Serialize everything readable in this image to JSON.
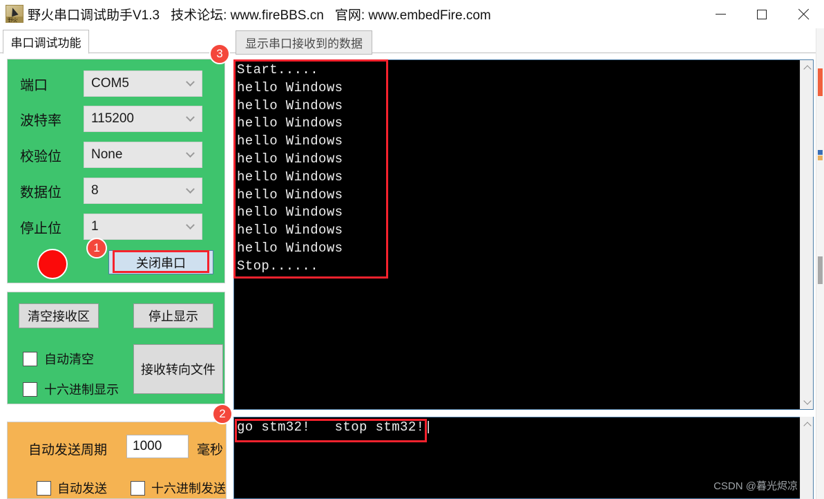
{
  "window": {
    "app_icon_name": "yehuo-logo-icon",
    "title_main": "野火串口调试助手V1.3",
    "title_forum": "技术论坛: www.fireBBS.cn",
    "title_site": "官网: www.embedFire.com",
    "minimize": "—",
    "maximize": "□",
    "close": "✕"
  },
  "tabs": {
    "left": "串口调试功能",
    "right": "显示串口接收到的数据"
  },
  "settings": {
    "rows": [
      {
        "label": "端口",
        "value": "COM5"
      },
      {
        "label": "波特率",
        "value": "115200"
      },
      {
        "label": "校验位",
        "value": "None"
      },
      {
        "label": "数据位",
        "value": "8"
      },
      {
        "label": "停止位",
        "value": "1"
      }
    ],
    "led_color": "#fb0a0a",
    "close_port_button": "关闭串口"
  },
  "receive_panel": {
    "clear_button": "清空接收区",
    "stop_button": "停止显示",
    "to_file_button": "接收转向文件",
    "auto_clear_label": "自动清空",
    "hex_display_label": "十六进制显示",
    "auto_clear_checked": false,
    "hex_display_checked": false
  },
  "send_panel": {
    "period_label": "自动发送周期",
    "period_value": "1000",
    "unit_label": "毫秒",
    "auto_send_label": "自动发送",
    "hex_send_label": "十六进制发送",
    "auto_send_checked": false,
    "hex_send_checked": false
  },
  "terminal": {
    "received_text": "Start.....\nhello Windows\nhello Windows\nhello Windows\nhello Windows\nhello Windows\nhello Windows\nhello Windows\nhello Windows\nhello Windows\nhello Windows\nStop......",
    "sent_text": "go stm32!   stop stm32!|"
  },
  "annotations": {
    "badge_1": "1",
    "badge_2": "2",
    "badge_3": "3",
    "highlight_color": "#f5222d"
  },
  "watermark": "CSDN @暮光烬凉",
  "theme": {
    "panel_green": "#3ec46d",
    "panel_orange": "#f5b352",
    "terminal_bg": "#000000",
    "terminal_fg": "#eeeeee",
    "badge_red": "#f4473b"
  }
}
